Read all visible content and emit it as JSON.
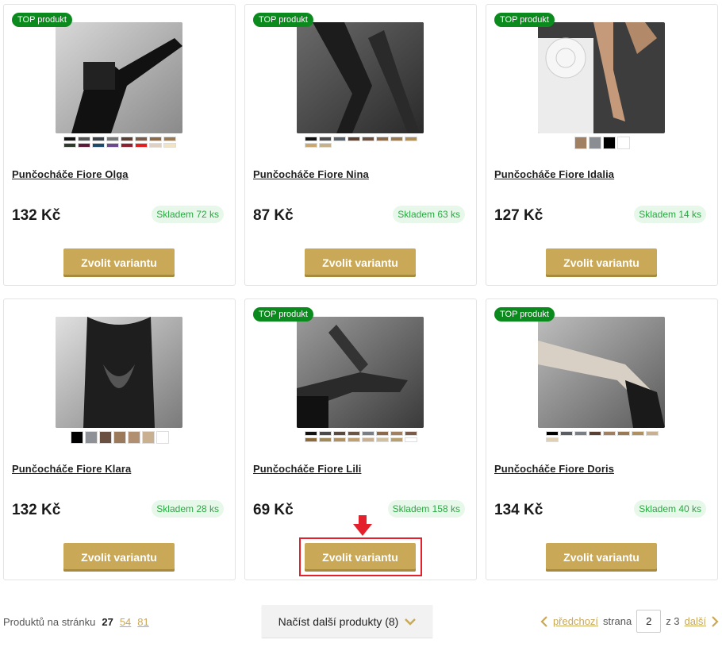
{
  "badge_text": "TOP produkt",
  "button_label": "Zvolit variantu",
  "products": [
    {
      "title": "Punčocháče Fiore Olga",
      "price": "132 Kč",
      "stock": "Skladem 72 ks",
      "top": true,
      "swatch_style": "small",
      "swatch_cols": 8,
      "swatches": [
        "#111111",
        "#555555",
        "#3a4048",
        "#777777",
        "#5a3d32",
        "#7a5a48",
        "#8a6a4a",
        "#9a7a55",
        "#2f3a2e",
        "#5a1a3a",
        "#1d4a6a",
        "#6a4a8a",
        "#8a2030",
        "#e02020",
        "#e0d0c0",
        "#f2e3c2"
      ]
    },
    {
      "title": "Punčocháče Fiore Nina",
      "price": "87 Kč",
      "stock": "Skladem 63 ks",
      "top": true,
      "swatch_style": "small",
      "swatch_cols": 8,
      "swatches": [
        "#111111",
        "#4a4a4a",
        "#5a6068",
        "#5a4032",
        "#6a5040",
        "#8a6a4a",
        "#9a7a55",
        "#b0905a",
        "#c8a870",
        "#c6b08a"
      ]
    },
    {
      "title": "Punčocháče Fiore Idalia",
      "price": "127 Kč",
      "stock": "Skladem 14 ks",
      "top": true,
      "swatch_style": "big",
      "swatch_cols": 4,
      "swatches": [
        "#a08060",
        "#8a8e92",
        "#000000",
        "#ffffff"
      ]
    },
    {
      "title": "Punčocháče Fiore Klara",
      "price": "132 Kč",
      "stock": "Skladem 28 ks",
      "top": false,
      "swatch_style": "big",
      "swatch_cols": 7,
      "swatches": [
        "#000000",
        "#8e9296",
        "#6a5040",
        "#9a7a5a",
        "#b09070",
        "#c8b090",
        "#ffffff"
      ]
    },
    {
      "title": "Punčocháče Fiore Lili",
      "price": "69 Kč",
      "stock": "Skladem 158 ks",
      "top": true,
      "swatch_style": "small",
      "swatch_cols": 8,
      "swatches": [
        "#111111",
        "#4a4a4a",
        "#5a4a40",
        "#6a5545",
        "#7a7f86",
        "#8a6a4a",
        "#a08060",
        "#7a5a48",
        "#8a6a3a",
        "#a08a5a",
        "#b09060",
        "#c0a070",
        "#c8b090",
        "#d0c0a0",
        "#b8a070",
        "#ffffff"
      ]
    },
    {
      "title": "Punčocháče Fiore Doris",
      "price": "134 Kč",
      "stock": "Skladem 40 ks",
      "top": true,
      "swatch_style": "small",
      "swatch_cols": 8,
      "swatches": [
        "#000000",
        "#5a5e62",
        "#7a7f86",
        "#5a4032",
        "#a08060",
        "#9a7a55",
        "#b09060",
        "#c8b090",
        "#e0d0b0"
      ]
    }
  ],
  "footer": {
    "per_page_label": "Produktů na stránku",
    "per_page_current": "27",
    "per_page_opt1": "54",
    "per_page_opt2": "81",
    "load_more": "Načíst další produkty (8)",
    "prev": "předchozí",
    "page_label": "strana",
    "page_value": "2",
    "page_total": "z 3",
    "next": "další"
  },
  "colors": {
    "accent": "#c9a857",
    "badge": "#0b8a1e",
    "stock_text": "#2aa842",
    "highlight": "#e3202b"
  }
}
